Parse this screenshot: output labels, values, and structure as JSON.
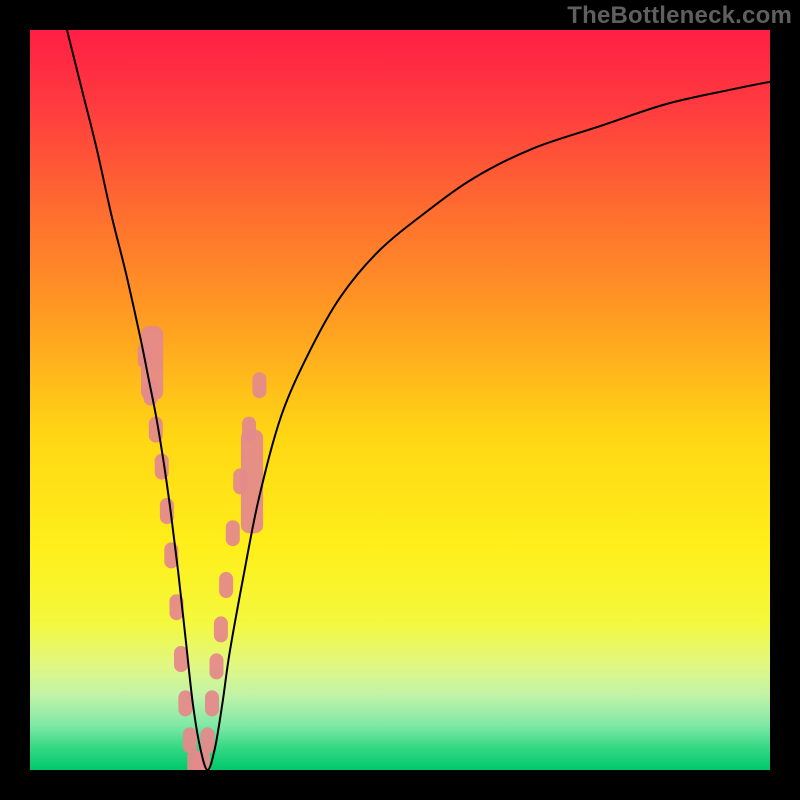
{
  "watermark": "TheBottleneck.com",
  "chart_data": {
    "type": "line",
    "title": "",
    "xlabel": "",
    "ylabel": "",
    "xlim": [
      0,
      100
    ],
    "ylim": [
      0,
      100
    ],
    "grid": false,
    "legend": false,
    "background_gradient_stops": [
      {
        "offset": 0.0,
        "color": "#ff1f44"
      },
      {
        "offset": 0.1,
        "color": "#ff3a3f"
      },
      {
        "offset": 0.25,
        "color": "#ff6f2f"
      },
      {
        "offset": 0.4,
        "color": "#ffa021"
      },
      {
        "offset": 0.55,
        "color": "#ffd714"
      },
      {
        "offset": 0.7,
        "color": "#ffef1a"
      },
      {
        "offset": 0.8,
        "color": "#f4f83d"
      },
      {
        "offset": 0.86,
        "color": "#e0f784"
      },
      {
        "offset": 0.9,
        "color": "#c0f3a8"
      },
      {
        "offset": 0.94,
        "color": "#7fe8a6"
      },
      {
        "offset": 0.97,
        "color": "#34d884"
      },
      {
        "offset": 1.0,
        "color": "#00c96b"
      }
    ],
    "series": [
      {
        "name": "bottleneck-curve",
        "color": "#000000",
        "width": 2,
        "x": [
          5,
          7,
          9,
          11,
          13,
          15,
          16,
          17,
          18,
          19,
          20,
          21,
          22,
          23,
          24,
          25,
          26,
          27,
          29,
          31,
          34,
          38,
          42,
          47,
          53,
          60,
          68,
          77,
          86,
          95,
          100
        ],
        "y": [
          100,
          92,
          84,
          75,
          67,
          58,
          53,
          48,
          42,
          35,
          27,
          18,
          9,
          3,
          0,
          3,
          9,
          16,
          27,
          37,
          48,
          57,
          64,
          70,
          75,
          80,
          84,
          87,
          90,
          92,
          93
        ]
      }
    ],
    "scatter": {
      "name": "highlight-band",
      "color": "#e58a8a",
      "x": [
        15.5,
        16.3,
        17.0,
        17.8,
        18.5,
        19.1,
        19.8,
        20.4,
        21.0,
        21.6,
        22.2,
        22.8,
        23.4,
        24.0,
        24.6,
        25.2,
        25.8,
        26.5,
        27.4,
        28.4,
        29.6,
        31.0
      ],
      "y": [
        56,
        51,
        46,
        41,
        35,
        29,
        22,
        15,
        9,
        4,
        1,
        0,
        1,
        4,
        9,
        14,
        19,
        25,
        32,
        39,
        46,
        52
      ],
      "rects": [
        {
          "x": 15.0,
          "y": 50,
          "w": 3.0,
          "h": 10
        },
        {
          "x": 28.5,
          "y": 32,
          "w": 3.0,
          "h": 14
        }
      ]
    }
  }
}
